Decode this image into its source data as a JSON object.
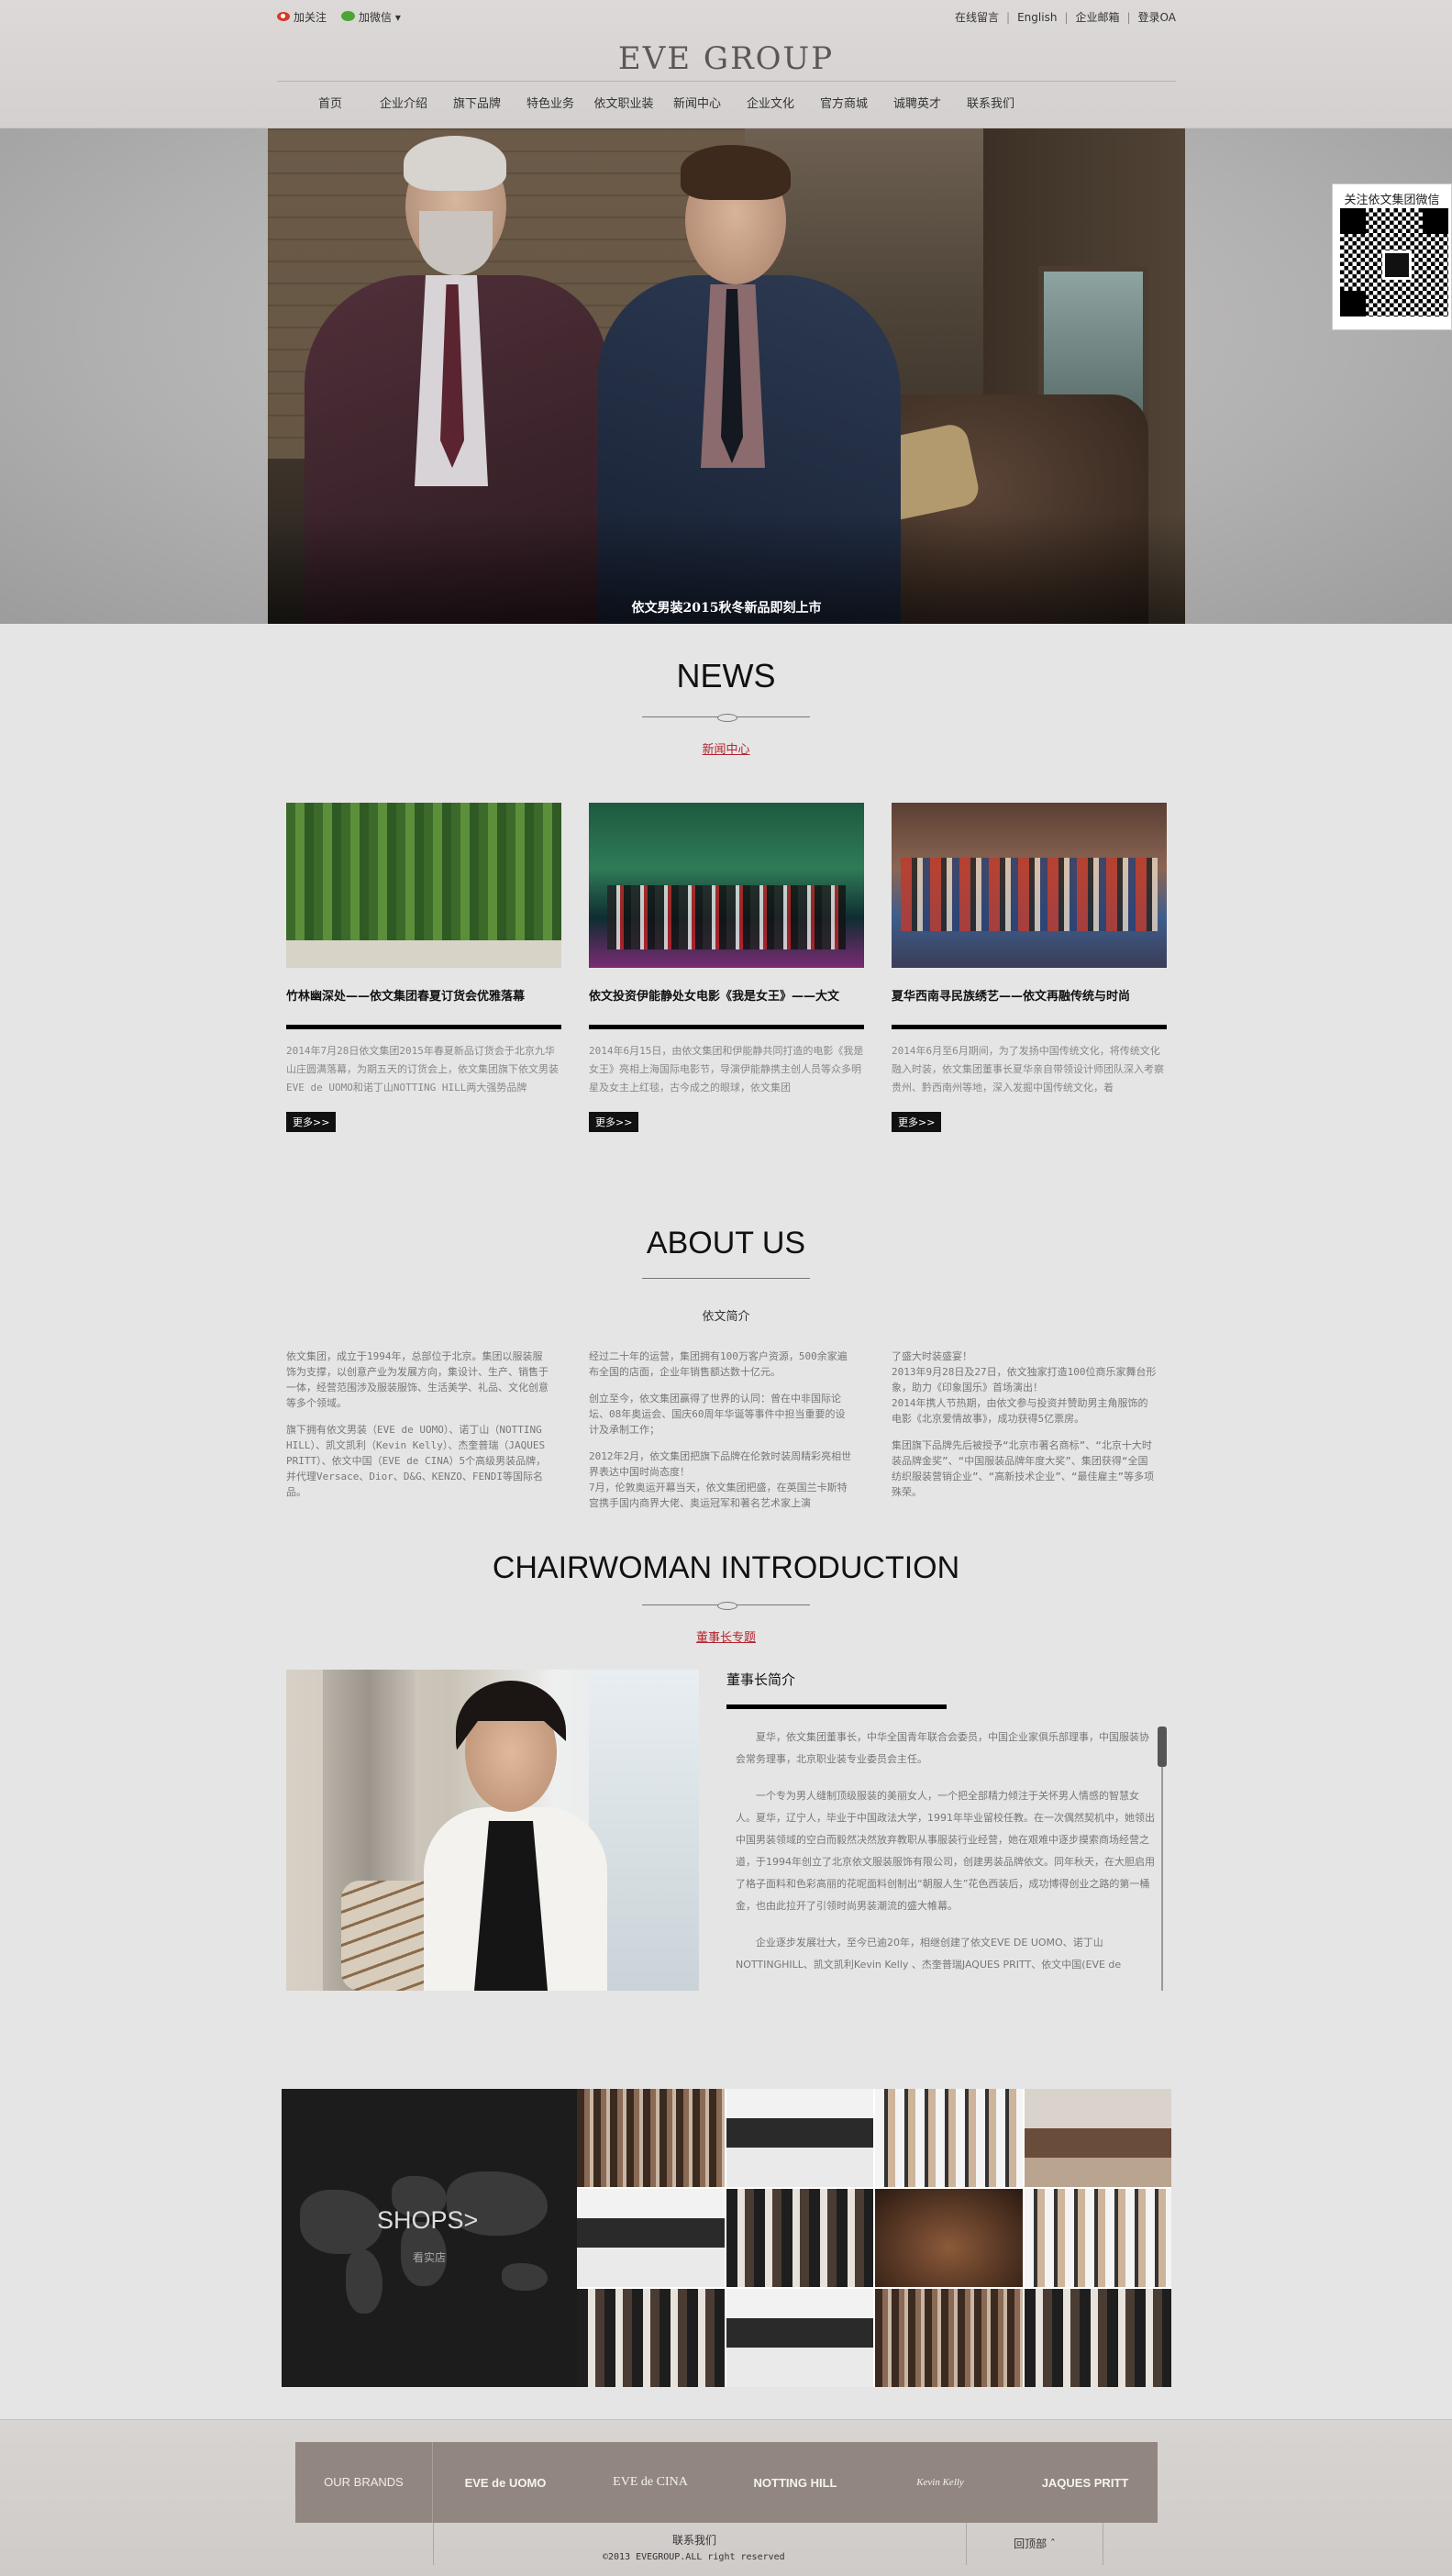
{
  "topbar": {
    "weibo_label": "加关注",
    "wechat_label": "加微信",
    "wechat_caret": "▾",
    "links": [
      "在线留言",
      "English",
      "企业邮箱",
      "登录OA"
    ]
  },
  "header": {
    "logo": "EVE GROUP",
    "nav": [
      "首页",
      "企业介绍",
      "旗下品牌",
      "特色业务",
      "依文职业装",
      "新闻中心",
      "企业文化",
      "官方商城",
      "诚聘英才",
      "联系我们"
    ]
  },
  "banner": {
    "caption": "依文男装2015秋冬新品即刻上市",
    "slides": [
      "1",
      "2",
      "3"
    ],
    "active_slide": "2"
  },
  "qr": {
    "title": "关注依文集团微信"
  },
  "news": {
    "title": "NEWS",
    "subtitle": "新闻中心",
    "more_label": "更多>>",
    "items": [
      {
        "title": "竹林幽深处——依文集团春夏订货会优雅落幕",
        "text": "2014年7月28日依文集团2015年春夏新品订货会于北京九华山庄圆满落幕，为期五天的订货会上，依文集团旗下依文男装EVE de UOMO和诺丁山NOTTING HILL两大强势品牌"
      },
      {
        "title": "依文投资伊能静处女电影《我是女王》——大文",
        "text": "2014年6月15日，由依文集团和伊能静共同打造的电影《我是女王》亮相上海国际电影节，导演伊能静携主创人员等众多明星及女主上红毯，古今成之的眼球，依文集团"
      },
      {
        "title": "夏华西南寻民族绣艺——依文再融传统与时尚",
        "text": "2014年6月至6月期间，为了发扬中国传统文化，将传统文化融入时装，依文集团董事长夏华亲自带领设计师团队深入考察贵州、黔西南州等地，深入发掘中国传统文化，着"
      }
    ]
  },
  "about": {
    "title": "ABOUT US",
    "subtitle": "依文简介",
    "columns": [
      [
        "依文集团，成立于1994年，总部位于北京。集团以服装服饰为支撑，以创意产业为发展方向，集设计、生产、销售于一体，经营范围涉及服装服饰、生活美学、礼品、文化创意等多个领域。",
        "旗下拥有依文男装（EVE de UOMO）、诺丁山（NOTTING HILL）、凯文凯利（Kevin Kelly）、杰奎普瑞（JAQUES PRITT）、依文中国（EVE de CINA）5个高级男装品牌，并代理Versace、Dior、D&G、KENZO、FENDI等国际名品。"
      ],
      [
        "经过二十年的运营，集团拥有100万客户资源，500余家遍布全国的店面，企业年销售额达数十亿元。",
        "创立至今，依文集团赢得了世界的认同：曾在中非国际论坛、08年奥运会、国庆60周年华诞等事件中担当重要的设计及承制工作；",
        "2012年2月，依文集团把旗下品牌在伦敦时装周精彩亮相世界表达中国时尚态度！",
        "7月，伦敦奥运开幕当天，依文集团把盛，在英国兰卡斯特宫携手国内商界大佬、奥运冠军和著名艺术家上演"
      ],
      [
        "了盛大时装盛宴！",
        "2013年9月28日及27日，依文独家打造100位商乐家舞台形象，助力《印象国乐》首场演出！",
        "2014年携人节热期，由依文参与投资并赞助男主角服饰的电影《北京爱情故事》，成功获得5亿票房。",
        "集团旗下品牌先后被授予“北京市著名商标”、“北京十大时装品牌金奖”、“中国服装品牌年度大奖”、集团获得“全国纺织服装营销企业”、“高新技术企业”、“最佳雇主”等多项殊荣。"
      ]
    ]
  },
  "chairwoman": {
    "title": "CHAIRWOMAN INTRODUCTION",
    "subtitle": "董事长专题",
    "heading": "董事长简介",
    "paragraphs": [
      "夏华，依文集团董事长，中华全国青年联合会委员，中国企业家俱乐部理事，中国服装协会常务理事，北京职业装专业委员会主任。",
      "一个专为男人缝制顶级服装的美丽女人，一个把全部精力倾注于关怀男人情感的智慧女人。夏华，辽宁人，毕业于中国政法大学，1991年毕业留校任教。在一次偶然契机中，她领出中国男装领域的空白而毅然决然放弃教职从事服装行业经营，她在艰难中逐步摸索商场经营之道，于1994年创立了北京依文服装服饰有限公司，创建男装品牌依文。同年秋天，在大胆启用了格子面料和色彩高丽的花呢面料创制出“朝服人生”花色西装后，成功博得创业之路的第一桶金，也由此拉开了引领时尚男装潮流的盛大帷幕。",
      "企业逐步发展壮大，至今已逾20年，相继创建了依文EVE DE UOMO、诺丁山NOTTINGHILL、凯文凯利Kevin Kelly 、杰奎普瑞JAQUES PRITT、依文中国(EVE de"
    ]
  },
  "shops": {
    "title": "SHOPS>",
    "subtitle": "看实店"
  },
  "footer": {
    "brands_label": "OUR BRANDS",
    "brands": [
      "EVE de UOMO",
      "EVE de CINA",
      "NOTTING HILL",
      "Kevin Kelly",
      "JAQUES PRITT"
    ],
    "contact": "联系我们",
    "copyright": "©2013 EVEGROUP.ALL right reserved",
    "back_to_top": "回顶部 ˆ"
  }
}
